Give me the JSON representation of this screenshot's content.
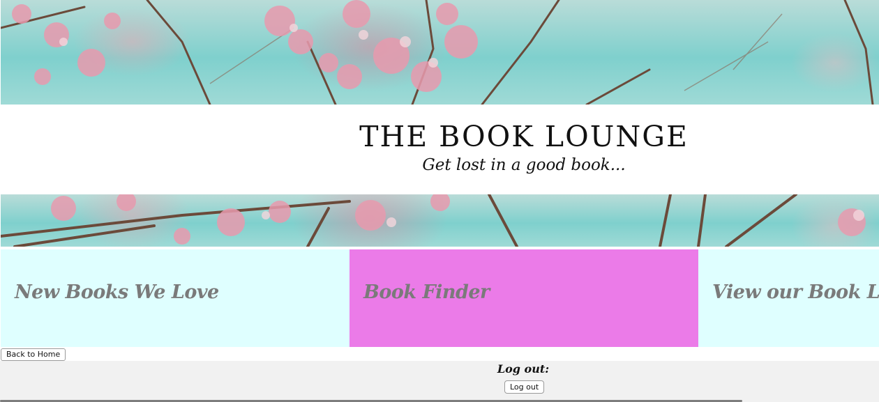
{
  "header": {
    "title": "THE BOOK LOUNGE",
    "tagline": "Get lost in a good book..."
  },
  "nav": {
    "items": [
      {
        "label": "New Books We Love",
        "color": "#dfffff"
      },
      {
        "label": "Book Finder",
        "color": "#eb7be8"
      },
      {
        "label": "View our Book Lists",
        "color": "#dfffff"
      }
    ]
  },
  "actions": {
    "back_label": "Back to Home"
  },
  "footer": {
    "logout_heading": "Log out:",
    "logout_label": "Log out"
  },
  "colors": {
    "nav_light": "#dfffff",
    "nav_active": "#eb7be8",
    "nav_text": "#7a7a7a",
    "footer_bg": "#f1f1f1"
  },
  "icons": [
    "cherry-blossom-banner-image"
  ]
}
